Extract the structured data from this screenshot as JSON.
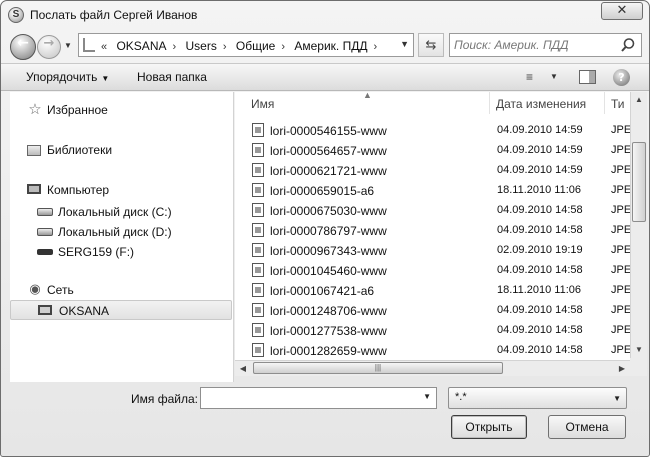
{
  "window": {
    "title": "Послать файл Сергей Иванов",
    "app_icon": "skype-icon",
    "close_glyph": "✕"
  },
  "address": {
    "overflow": "«",
    "path": [
      "OKSANA",
      "Users",
      "Общие",
      "Америк. ПДД"
    ],
    "search_placeholder": "Поиск: Америк. ПДД"
  },
  "toolbar": {
    "organize_label": "Упорядочить",
    "new_folder_label": "Новая папка",
    "help_glyph": "?"
  },
  "nav": {
    "favorites": "Избранное",
    "libraries": "Библиотеки",
    "computer": "Компьютер",
    "drive_c": "Локальный диск (C:)",
    "drive_d": "Локальный диск (D:)",
    "drive_f": "SERG159 (F:)",
    "network": "Сеть",
    "oksana": "OKSANA"
  },
  "columns": {
    "name": "Имя",
    "date": "Дата изменения",
    "type": "Ти"
  },
  "files": [
    {
      "name": "lori-0000546155-www",
      "date": "04.09.2010 14:59",
      "type": "JPE"
    },
    {
      "name": "lori-0000564657-www",
      "date": "04.09.2010 14:59",
      "type": "JPE"
    },
    {
      "name": "lori-0000621721-www",
      "date": "04.09.2010 14:59",
      "type": "JPE"
    },
    {
      "name": "lori-0000659015-a6",
      "date": "18.11.2010 11:06",
      "type": "JPE"
    },
    {
      "name": "lori-0000675030-www",
      "date": "04.09.2010 14:58",
      "type": "JPE"
    },
    {
      "name": "lori-0000786797-www",
      "date": "04.09.2010 14:58",
      "type": "JPE"
    },
    {
      "name": "lori-0000967343-www",
      "date": "02.09.2010 19:19",
      "type": "JPE"
    },
    {
      "name": "lori-0001045460-www",
      "date": "04.09.2010 14:58",
      "type": "JPE"
    },
    {
      "name": "lori-0001067421-a6",
      "date": "18.11.2010 11:06",
      "type": "JPE"
    },
    {
      "name": "lori-0001248706-www",
      "date": "04.09.2010 14:58",
      "type": "JPE"
    },
    {
      "name": "lori-0001277538-www",
      "date": "04.09.2010 14:58",
      "type": "JPE"
    },
    {
      "name": "lori-0001282659-www",
      "date": "04.09.2010 14:58",
      "type": "JPE"
    }
  ],
  "footer": {
    "filename_label": "Имя файла:",
    "filename_value": "",
    "filter_value": "*.*",
    "open_label": "Открыть",
    "cancel_label": "Отмена"
  }
}
